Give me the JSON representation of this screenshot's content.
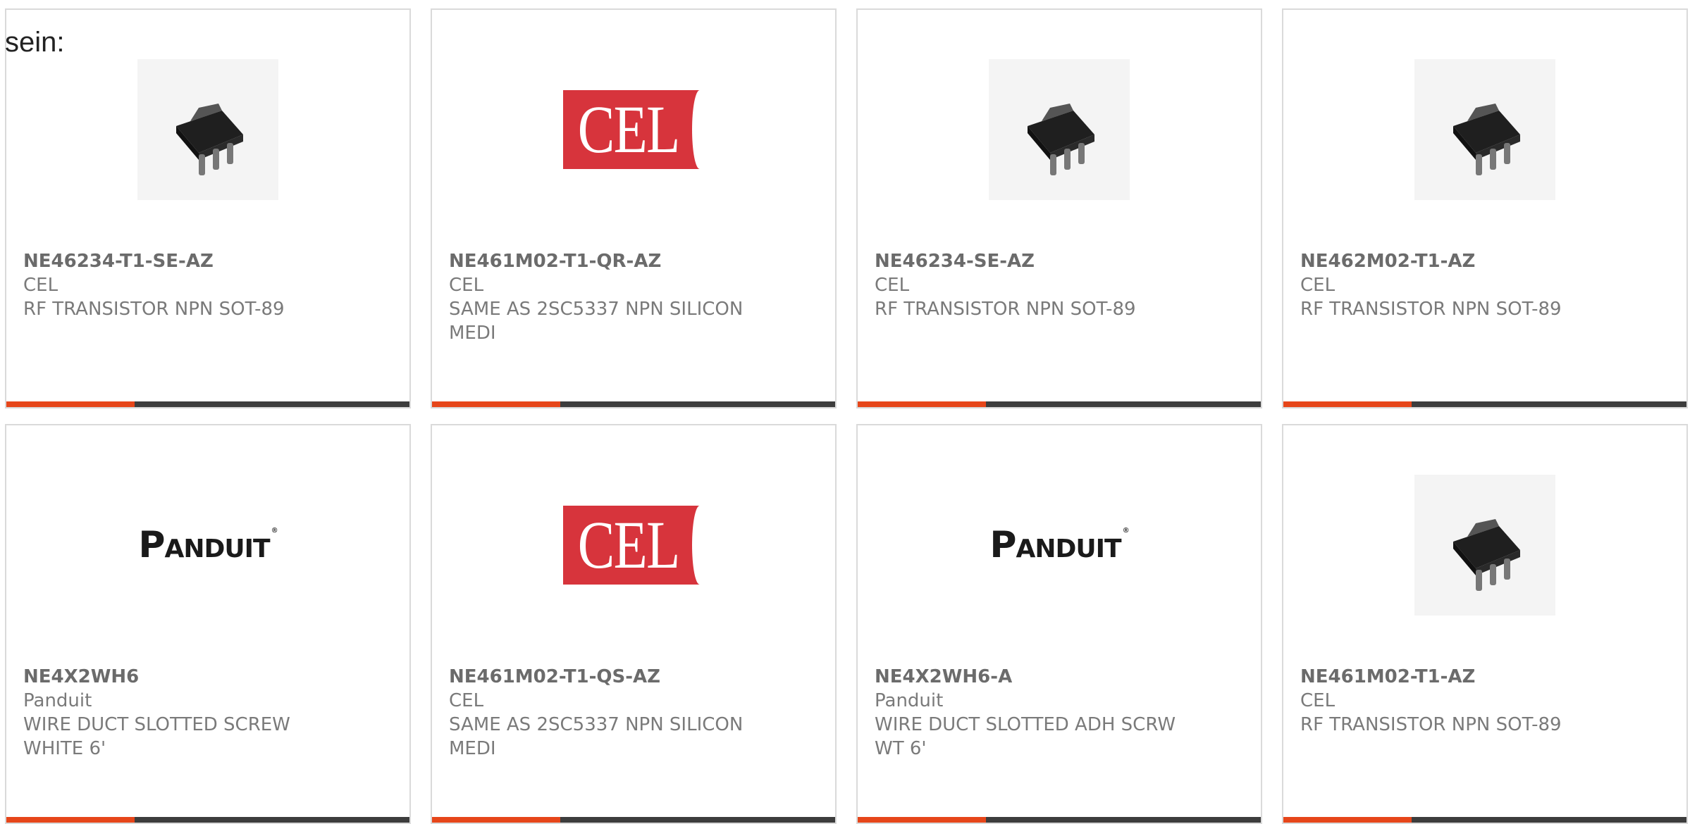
{
  "intro_text": "sein:",
  "colors": {
    "accent": "#e6461a",
    "bar": "#3d3d3d",
    "cel_red": "#d7343c"
  },
  "products": [
    {
      "part": "NE46234-T1-SE-AZ",
      "maker": "CEL",
      "desc": "RF TRANSISTOR NPN SOT-89",
      "image": "transistor"
    },
    {
      "part": "NE461M02-T1-QR-AZ",
      "maker": "CEL",
      "desc": "SAME AS 2SC5337 NPN SILICON MEDI",
      "image": "cel-logo"
    },
    {
      "part": "NE46234-SE-AZ",
      "maker": "CEL",
      "desc": "RF TRANSISTOR NPN SOT-89",
      "image": "transistor"
    },
    {
      "part": "NE462M02-T1-AZ",
      "maker": "CEL",
      "desc": "RF TRANSISTOR NPN SOT-89",
      "image": "transistor"
    },
    {
      "part": "NE4X2WH6",
      "maker": "Panduit",
      "desc": "WIRE DUCT SLOTTED SCREW WHITE 6'",
      "image": "panduit-logo"
    },
    {
      "part": "NE461M02-T1-QS-AZ",
      "maker": "CEL",
      "desc": "SAME AS 2SC5337 NPN SILICON MEDI",
      "image": "cel-logo"
    },
    {
      "part": "NE4X2WH6-A",
      "maker": "Panduit",
      "desc": "WIRE DUCT SLOTTED ADH SCRW WT 6'",
      "image": "panduit-logo"
    },
    {
      "part": "NE461M02-T1-AZ",
      "maker": "CEL",
      "desc": "RF TRANSISTOR NPN SOT-89",
      "image": "transistor"
    }
  ],
  "logo_text": {
    "cel": "CEL",
    "panduit_first": "P",
    "panduit_rest": "ANDUIT",
    "panduit_reg": "®"
  }
}
